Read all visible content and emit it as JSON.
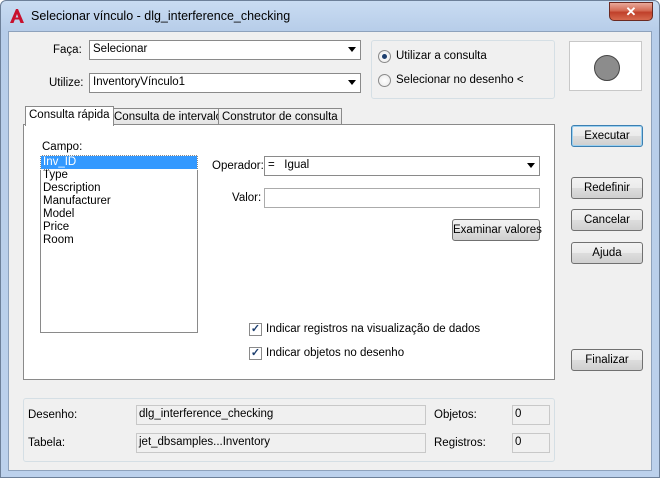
{
  "window": {
    "title": "Selecionar vínculo - dlg_interference_checking",
    "close_glyph": "✕"
  },
  "top": {
    "faca_label": "Faça:",
    "faca_value": "Selecionar",
    "utilize_label": "Utilize:",
    "utilize_value": "InventoryVínculo1"
  },
  "radio_group": {
    "option1": "Utilizar a consulta",
    "option2": "Selecionar no desenho <",
    "selected": 1
  },
  "tabs": [
    {
      "label": "Consulta rápida",
      "active": true
    },
    {
      "label": "Consulta de intervalo",
      "active": false
    },
    {
      "label": "Construtor de consulta",
      "active": false
    }
  ],
  "quick_query": {
    "campo_label": "Campo:",
    "fields": [
      "Inv_ID",
      "Type",
      "Description",
      "Manufacturer",
      "Model",
      "Price",
      "Room"
    ],
    "selected_field": 0,
    "operador_label": "Operador:",
    "operador_value": "=   Igual",
    "valor_label": "Valor:",
    "valor_value": "",
    "examinar_button": "Examinar valores",
    "check1_label": "Indicar registros na visualização de dados",
    "check1_checked": true,
    "check2_label": "Indicar objetos no desenho",
    "check2_checked": true
  },
  "buttons": {
    "executar": "Executar",
    "redefinir": "Redefinir",
    "cancelar": "Cancelar",
    "ajuda": "Ajuda",
    "finalizar": "Finalizar"
  },
  "status": {
    "desenho_label": "Desenho:",
    "desenho_value": "dlg_interference_checking",
    "tabela_label": "Tabela:",
    "tabela_value": "jet_dbsamples...Inventory",
    "objetos_label": "Objetos:",
    "objetos_value": "0",
    "registros_label": "Registros:",
    "registros_value": "0"
  },
  "colors": {
    "accent": "#3399ff",
    "app_icon": "#c8102e"
  }
}
